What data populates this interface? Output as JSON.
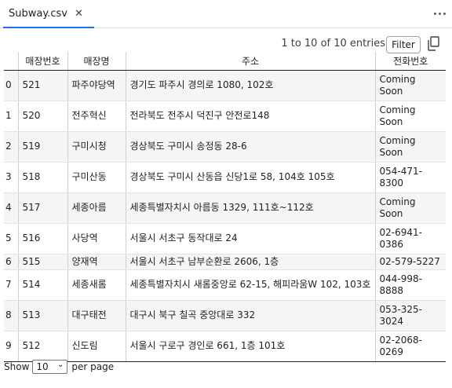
{
  "tab": {
    "title": "Subway.csv",
    "close_glyph": "✕"
  },
  "menu": {
    "icon": "more-vertical-icon"
  },
  "toolbar": {
    "entries_text": "1 to 10 of 10 entries",
    "filter_label": "Filter",
    "copy_icon": "copy-icon"
  },
  "table": {
    "columns": [
      "",
      "매장번호",
      "매장명",
      "주소",
      "전화번호"
    ],
    "rows": [
      {
        "index": "0",
        "store_no": "521",
        "name": "파주야당역",
        "address": "경기도 파주시 경의로 1080, 102호",
        "phone": "Coming Soon"
      },
      {
        "index": "1",
        "store_no": "520",
        "name": "전주혁신",
        "address": "전라북도 전주시 덕진구 안전로148",
        "phone": "Coming Soon"
      },
      {
        "index": "2",
        "store_no": "519",
        "name": "구미시청",
        "address": "경상북도 구미시 송정동 28-6",
        "phone": "Coming Soon"
      },
      {
        "index": "3",
        "store_no": "518",
        "name": "구미산동",
        "address": "경상북도 구미시 산동읍 신당1로 58, 104호 105호",
        "phone": "054-471-8300"
      },
      {
        "index": "4",
        "store_no": "517",
        "name": "세종아름",
        "address": "세종특별자치시 아름동 1329, 111호~112호",
        "phone": "Coming Soon"
      },
      {
        "index": "5",
        "store_no": "516",
        "name": "사당역",
        "address": "서울시 서초구 동작대로 24",
        "phone": "02-6941-0386"
      },
      {
        "index": "6",
        "store_no": "515",
        "name": "양재역",
        "address": "서울시 서초구 남부순환로 2606, 1층",
        "phone": "02-579-5227"
      },
      {
        "index": "7",
        "store_no": "514",
        "name": "세종새롬",
        "address": "세종특별자치시 새롬중앙로 62-15, 해피라움W 102, 103호",
        "phone": "044-998-8888"
      },
      {
        "index": "8",
        "store_no": "513",
        "name": "대구태전",
        "address": "대구시 북구 칠곡 중앙대로 332",
        "phone": "053-325-3024"
      },
      {
        "index": "9",
        "store_no": "512",
        "name": "신도림",
        "address": "서울시 구로구 경인로 661, 1층 101호",
        "phone": "02-2068-0269"
      }
    ]
  },
  "footer": {
    "show_label": "Show",
    "page_size": "10",
    "per_page_label": "per page"
  }
}
